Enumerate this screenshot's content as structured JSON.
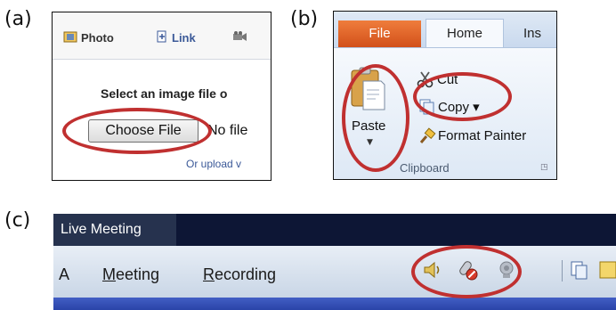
{
  "panel_labels": {
    "a": "(a)",
    "b": "(b)",
    "c": "(c)"
  },
  "panel_a": {
    "tabs": [
      {
        "label": "Photo",
        "icon": "photo-icon"
      },
      {
        "label": "Link",
        "icon": "link-icon"
      },
      {
        "label": "",
        "icon": "video-icon"
      }
    ],
    "select_text": "Select an image file o",
    "choose_file_button": "Choose File",
    "no_file_text": "No file",
    "upload_link": "Or upload v"
  },
  "panel_b": {
    "tabs": {
      "file": "File",
      "home": "Home",
      "insert_partial": "Ins"
    },
    "paste_label": "Paste",
    "cut_label": "Cut",
    "copy_label": "Copy ▾",
    "format_painter_label": "Format Painter",
    "group_label": "Clipboard",
    "icons": [
      "paste-icon",
      "scissors-icon",
      "copy-icon",
      "format-painter-icon",
      "dialog-launcher-icon"
    ]
  },
  "panel_c": {
    "title": "Live Meeting",
    "menu_partial": "A",
    "menus": [
      {
        "label": "Meeting",
        "accel": "M",
        "rest": "eeting"
      },
      {
        "label": "Recording",
        "accel": "R",
        "rest": "ecording"
      }
    ],
    "icons": [
      "speaker-icon",
      "microphone-muted-icon",
      "webcam-icon",
      "handouts-icon",
      "notes-icon"
    ]
  },
  "colors": {
    "highlight_ellipse": "#c03030",
    "office_file_tab": "#e0652a",
    "live_meeting_titlebar": "#0d1635",
    "facebook_link": "#3b5998"
  }
}
